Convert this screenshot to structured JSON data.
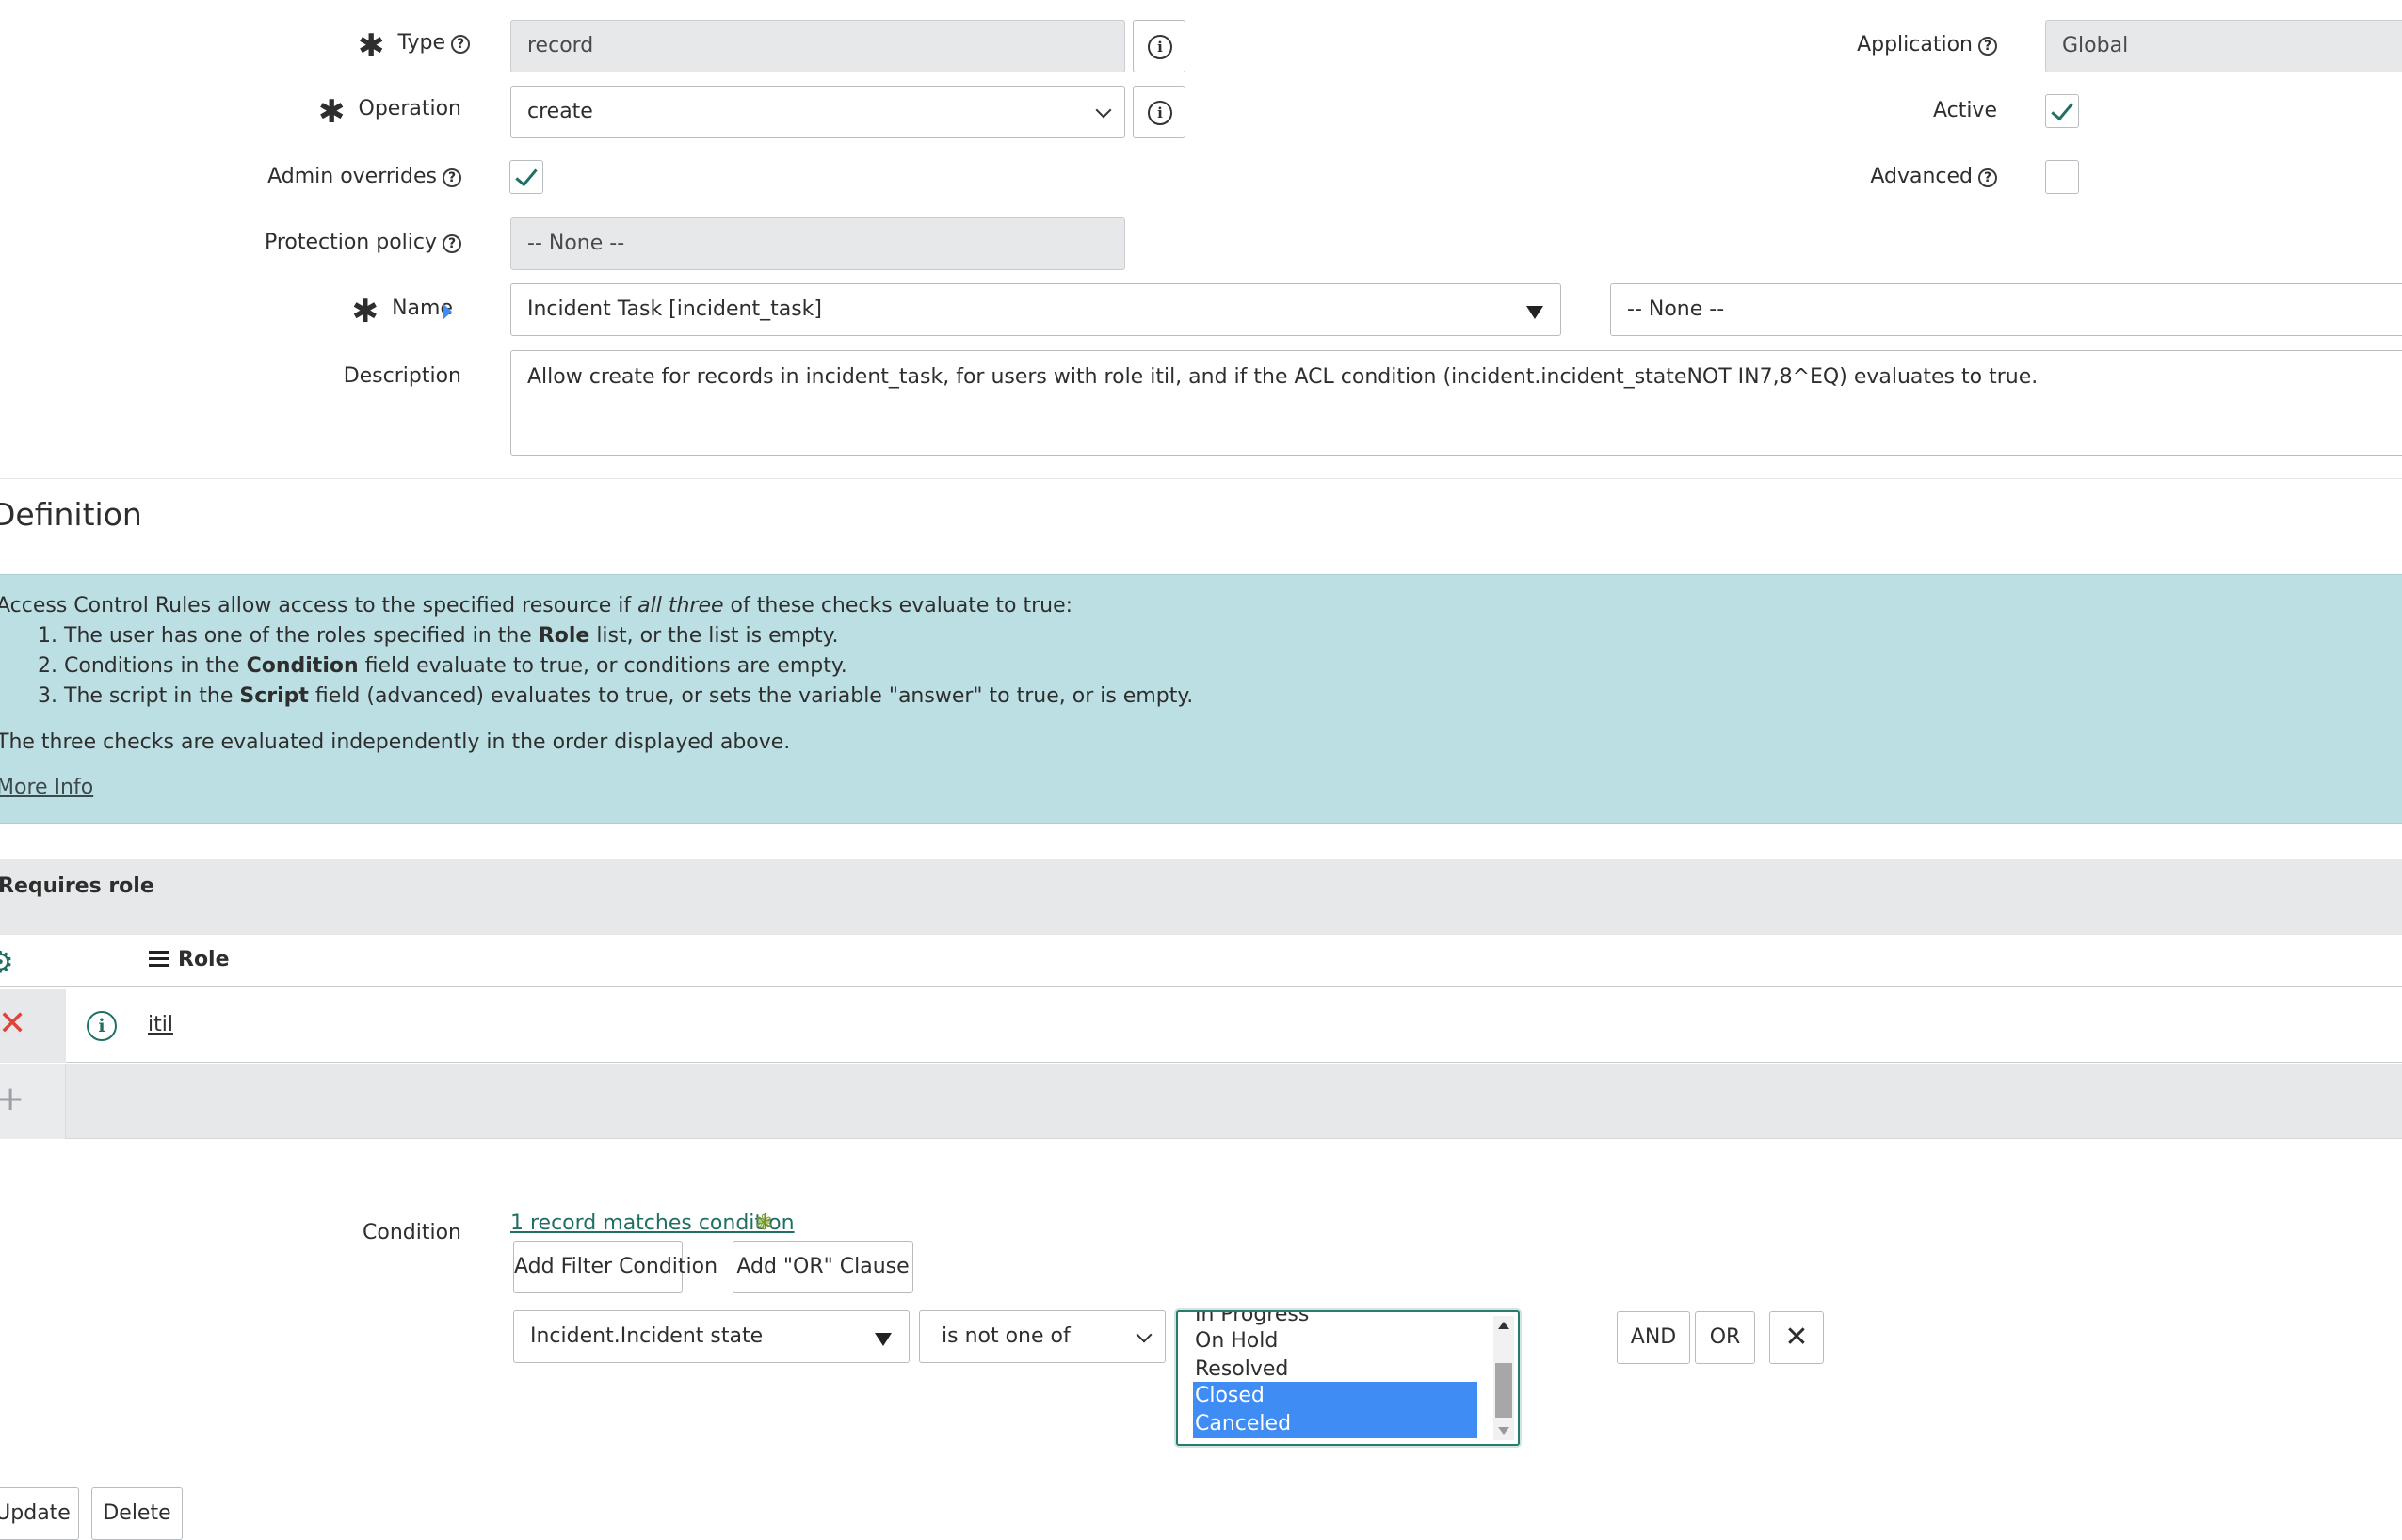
{
  "form": {
    "type": {
      "label": "Type",
      "value": "record"
    },
    "operation": {
      "label": "Operation",
      "value": "create"
    },
    "admin_overrides": {
      "label": "Admin overrides",
      "checked": true
    },
    "protection_policy": {
      "label": "Protection policy",
      "value": "-- None --"
    },
    "name": {
      "label": "Name",
      "value": "Incident Task [incident_task]",
      "field_value": "-- None --"
    },
    "description": {
      "label": "Description",
      "value": "Allow create for records in incident_task, for users with role itil, and if the ACL condition (incident.incident_stateNOT IN7,8^EQ) evaluates to true."
    },
    "application": {
      "label": "Application",
      "value": "Global"
    },
    "active": {
      "label": "Active",
      "checked": true
    },
    "advanced": {
      "label": "Advanced",
      "checked": false
    }
  },
  "definition": {
    "title": "Definition",
    "intro_pre": "Access Control Rules allow access to the specified resource if ",
    "intro_em": "all three",
    "intro_post": " of these checks evaluate to true:",
    "items": [
      {
        "num": "1.",
        "pre": "The user has one of the roles specified in the ",
        "bold": "Role",
        "post": " list, or the list is empty."
      },
      {
        "num": "2.",
        "pre": "Conditions in the ",
        "bold": "Condition",
        "post": " field evaluate to true, or conditions are empty."
      },
      {
        "num": "3.",
        "pre": "The script in the ",
        "bold": "Script",
        "post": " field (advanced) evaluates to true, or sets the variable \"answer\" to true, or is empty."
      }
    ],
    "footer": "The three checks are evaluated independently in the order displayed above.",
    "more_info": "More Info"
  },
  "roles": {
    "header": "Requires role",
    "column": "Role",
    "rows": [
      {
        "role": "itil"
      }
    ]
  },
  "condition": {
    "label": "Condition",
    "matches_link": "1 record matches condition",
    "add_filter": "Add Filter Condition",
    "add_or": "Add \"OR\" Clause",
    "field": "Incident.Incident state",
    "operator": "is not one of",
    "options": [
      "In Progress",
      "On Hold",
      "Resolved",
      "Closed",
      "Canceled"
    ],
    "selected": [
      "Closed",
      "Canceled"
    ],
    "and_label": "AND",
    "or_label": "OR"
  },
  "actions": {
    "update": "Update",
    "delete": "Delete"
  },
  "colors": {
    "accent": "#1f6f65",
    "info_bg": "#bcdfe3",
    "selected": "#3f8cf5",
    "delete": "#e0433a"
  },
  "icons": [
    "required-asterisk-icon",
    "help-icon",
    "info-icon",
    "checkmark-icon",
    "chevron-down-icon",
    "dropdown-triangle-icon",
    "gear-icon",
    "list-menu-icon",
    "close-icon",
    "plus-icon"
  ]
}
